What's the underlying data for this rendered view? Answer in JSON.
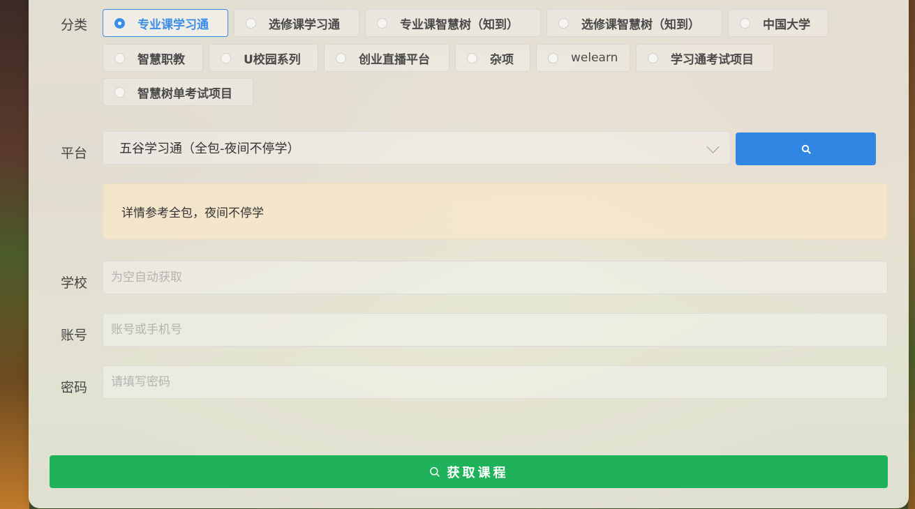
{
  "form": {
    "category_label": "分类",
    "categories": [
      "专业课学习通",
      "选修课学习通",
      "专业课智慧树（知到）",
      "选修课智慧树（知到）",
      "中国大学",
      "智慧职教",
      "U校园系列",
      "创业直播平台",
      "杂项",
      "welearn",
      "学习通考试项目",
      "智慧树单考试项目"
    ],
    "selected_category": "专业课学习通",
    "platform_label": "平台",
    "platform_value": "五谷学习通（全包-夜间不停学）",
    "notice": "详情参考全包，夜间不停学",
    "school_label": "学校",
    "school_placeholder": "为空自动获取",
    "account_label": "账号",
    "account_placeholder": "账号或手机号",
    "password_label": "密码",
    "password_placeholder": "请填写密码",
    "submit_label": "获取课程"
  },
  "colors": {
    "accent_blue": "#3185e3",
    "submit_green": "#1fb25a",
    "notice_bg": "#fae8c8"
  },
  "icons": {
    "search_button": "search-icon",
    "submit_button": "search-icon",
    "select_arrow": "chevron-down-icon"
  }
}
